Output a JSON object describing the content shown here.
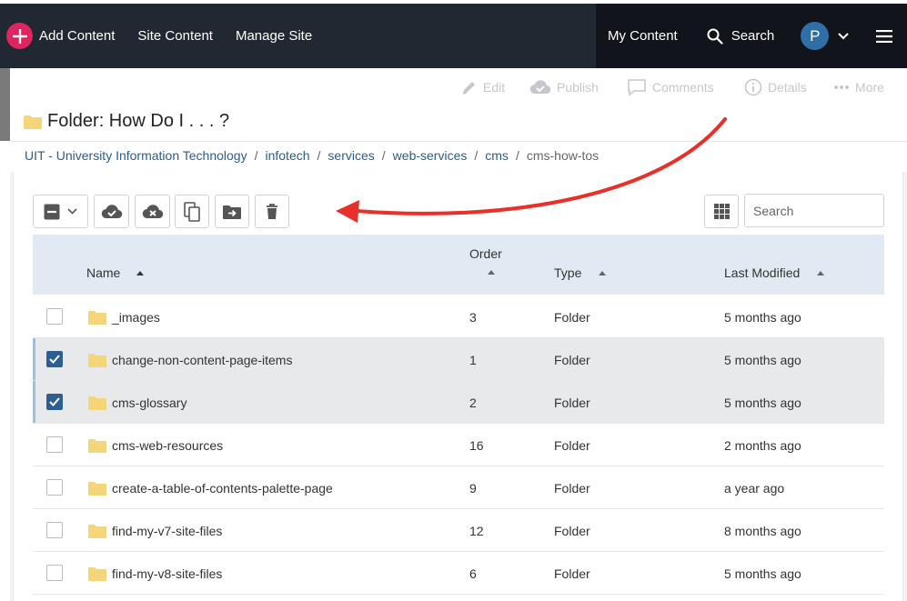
{
  "topbar": {
    "add_content": "Add Content",
    "site_content": "Site Content",
    "manage_site": "Manage Site",
    "my_content": "My Content",
    "search": "Search",
    "avatar_initial": "P"
  },
  "actions": {
    "edit": "Edit",
    "publish": "Publish",
    "comments": "Comments",
    "details": "Details",
    "more": "More"
  },
  "page": {
    "title": "Folder: How Do I . . . ?"
  },
  "breadcrumb": {
    "items": [
      "UIT - University Information Technology",
      "infotech",
      "services",
      "web-services",
      "cms"
    ],
    "current": "cms-how-tos",
    "separator": "/"
  },
  "toolbar": {
    "search_placeholder": "Search"
  },
  "table": {
    "columns": {
      "name": "Name",
      "order": "Order",
      "type": "Type",
      "modified": "Last Modified"
    },
    "rows": [
      {
        "name": "_images",
        "order": "3",
        "type": "Folder",
        "modified": "5 months ago",
        "selected": false
      },
      {
        "name": "change-non-content-page-items",
        "order": "1",
        "type": "Folder",
        "modified": "5 months ago",
        "selected": true
      },
      {
        "name": "cms-glossary",
        "order": "2",
        "type": "Folder",
        "modified": "5 months ago",
        "selected": true
      },
      {
        "name": "cms-web-resources",
        "order": "16",
        "type": "Folder",
        "modified": "2 months ago",
        "selected": false
      },
      {
        "name": "create-a-table-of-contents-palette-page",
        "order": "9",
        "type": "Folder",
        "modified": "a year ago",
        "selected": false
      },
      {
        "name": "find-my-v7-site-files",
        "order": "12",
        "type": "Folder",
        "modified": "8 months ago",
        "selected": false
      },
      {
        "name": "find-my-v8-site-files",
        "order": "6",
        "type": "Folder",
        "modified": "5 months ago",
        "selected": false
      }
    ]
  },
  "colors": {
    "topbar": "#222831",
    "topbar_right": "#11151b",
    "accent_pink": "#e0245e",
    "link_blue": "#2b5d8a",
    "checkbox_blue": "#2c5e91",
    "header_bg": "#e1eaf3",
    "folder": "#f5d57a",
    "annotation_arrow": "#e8302a"
  }
}
